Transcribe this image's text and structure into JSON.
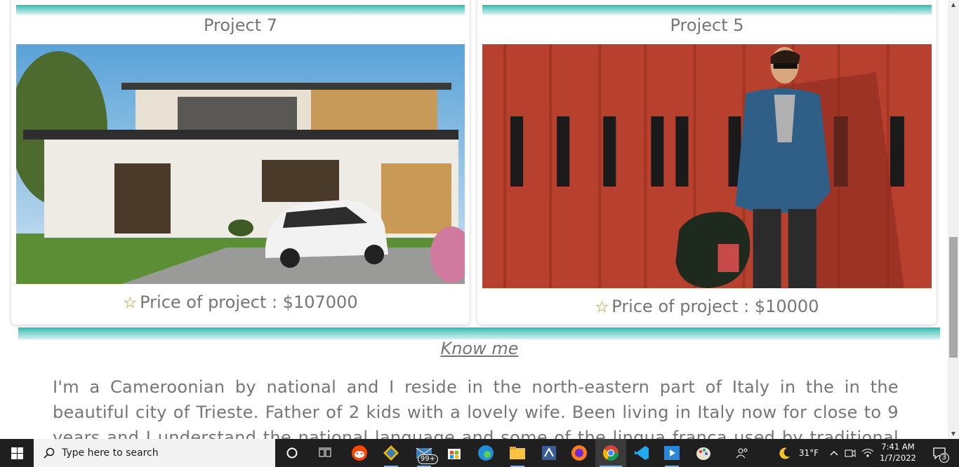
{
  "projects": [
    {
      "title": "Project 7",
      "price_label": "Price of project : $107000"
    },
    {
      "title": "Project 5",
      "price_label": "Price of project : $10000"
    }
  ],
  "star_glyph": "☆",
  "about": {
    "heading": "Know me",
    "text": "I'm a Cameroonian by national and I reside in the north-eastern part of Italy in the in the beautiful city of Trieste. Father of 2 kids with a lovely wife. Been living in Italy now for close to 9 years and I understand the national language and some of the lingua franca used by traditional italians. I am"
  },
  "colors": {
    "accent_teal": "#2fb6ad",
    "text_gray": "#767676",
    "taskbar_bg": "#1f1f1f"
  },
  "taskbar": {
    "search_placeholder": "Type here to search",
    "apps": [
      {
        "name": "cortana-icon"
      },
      {
        "name": "task-view-icon"
      },
      {
        "name": "reddit-app-icon"
      },
      {
        "name": "git-app-icon"
      },
      {
        "name": "mail-app-icon",
        "badge": "99+"
      },
      {
        "name": "store-app-icon"
      },
      {
        "name": "edge-app-icon"
      },
      {
        "name": "file-explorer-icon"
      },
      {
        "name": "ssms-app-icon"
      },
      {
        "name": "firefox-app-icon"
      },
      {
        "name": "chrome-app-icon"
      },
      {
        "name": "vscode-app-icon"
      },
      {
        "name": "media-player-icon"
      },
      {
        "name": "paint-app-icon"
      }
    ],
    "weather_temp": "31°F",
    "time": "7:41 AM",
    "date": "1/7/2022",
    "notification_count": "3"
  }
}
